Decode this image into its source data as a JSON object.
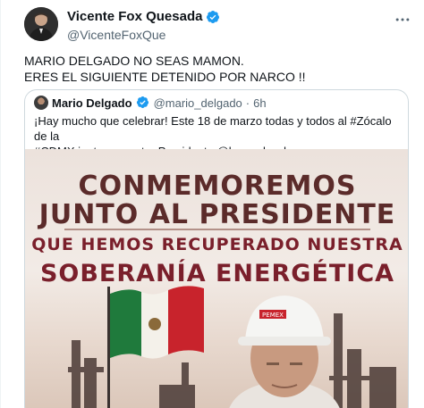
{
  "author": {
    "display_name": "Vicente Fox Quesada",
    "handle": "@VicenteFoxQue",
    "verified": true
  },
  "tweet": {
    "line1": "MARIO DELGADO NO SEAS MAMON.",
    "line2": "ERES EL SIGUIENTE DETENIDO POR NARCO !!"
  },
  "quote": {
    "display_name": "Mario Delgado",
    "handle": "@mario_delgado",
    "separator": "·",
    "time": "6h",
    "text_line1": "¡Hay mucho que celebrar! Este 18 de marzo todas y todos al #Zócalo de la",
    "text_line2": "#CDMX junto a nuestro Presidente @lopezobrador_.",
    "image": {
      "line1": "CONMEMOREMOS",
      "line2": "JUNTO AL PRESIDENTE",
      "line3": "QUE HEMOS RECUPERADO NUESTRA",
      "line4": "SOBERANÍA ENERGÉTICA",
      "helmet_text": "PEMEX"
    }
  },
  "icons": {
    "verified": "verified-badge-icon",
    "more": "more-horizontal-icon"
  },
  "colors": {
    "verified_blue": "#1d9bf0",
    "poster_dark": "#5b2b2a",
    "poster_red": "#7a1f2b"
  }
}
